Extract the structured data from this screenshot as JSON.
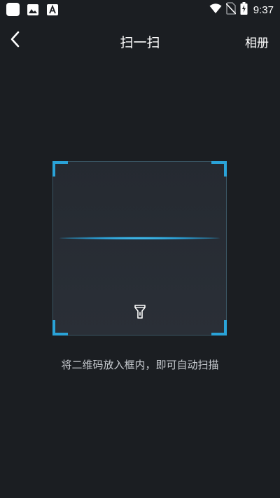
{
  "status_bar": {
    "time": "9:37",
    "icons": [
      "app-notification-icon",
      "image-icon",
      "text-a-icon",
      "wifi-icon",
      "no-sim-icon",
      "battery-charging-icon"
    ]
  },
  "header": {
    "title": "扫一扫",
    "right_action_label": "相册",
    "back_icon": "chevron-left-icon"
  },
  "scanner": {
    "accent_color": "#2aa3d8",
    "flashlight_icon": "flashlight-icon",
    "hint": "将二维码放入框内，即可自动扫描"
  },
  "colors": {
    "background": "#1b1e22",
    "frame_fill": "#272c33"
  }
}
